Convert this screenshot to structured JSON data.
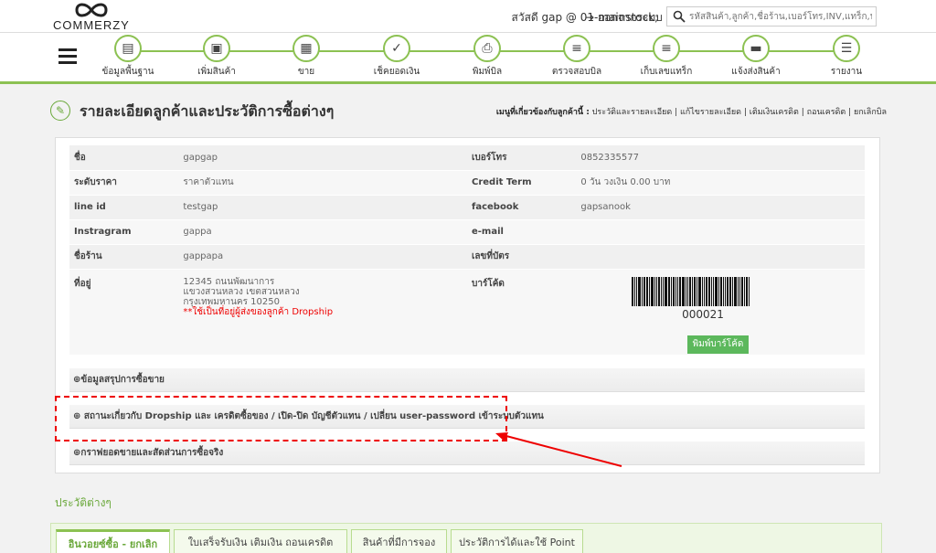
{
  "header": {
    "logo_text": "COMMERZY",
    "greeting_prefix": "สวัสดี",
    "user": "gap @ 01-mainstock,",
    "logout_label": "ออกจากระบบ",
    "search_placeholder": "รหัสสินค้า,ลูกค้า,ชื่อร้าน,เบอร์โทร,INV,แทร็ก,ปลายทาง"
  },
  "nav": {
    "items": [
      {
        "label": "ข้อมูลพื้นฐาน",
        "icon": "database-icon"
      },
      {
        "label": "เพิ่มสินค้า",
        "icon": "box-icon"
      },
      {
        "label": "ขาย",
        "icon": "cash-register-icon"
      },
      {
        "label": "เช็คยอดเงิน",
        "icon": "check-money-icon"
      },
      {
        "label": "พิมพ์บิล",
        "icon": "printer-icon"
      },
      {
        "label": "ตรวจสอบบิล",
        "icon": "barcode-scanner-icon"
      },
      {
        "label": "เก็บเลขแทร็ก",
        "icon": "scanner-icon"
      },
      {
        "label": "แจ้งส่งสินค้า",
        "icon": "truck-icon"
      },
      {
        "label": "รายงาน",
        "icon": "report-icon"
      }
    ]
  },
  "page": {
    "title": "รายละเอียดลูกค้าและประวัติการซื้อต่างๆ",
    "related_menu_label": "เมนูที่เกี่ยวข้องกับลูกค้านี้ :",
    "related_menu_links": "ประวัติและรายละเอียด | แก้ไขรายละเอียด | เติมเงินเครดิต | ถอนเครดิต | ยกเลิกบิล"
  },
  "customer": {
    "name_label": "ชื่อ",
    "name": "gapgap",
    "phone_label": "เบอร์โทร",
    "phone": "0852335577",
    "price_level_label": "ระดับราคา",
    "price_level": "ราคาตัวแทน",
    "credit_term_label": "Credit Term",
    "credit_term": "0 วัน วงเงิน 0.00 บาท",
    "line_label": "line id",
    "line": "testgap",
    "facebook_label": "facebook",
    "facebook": "gapsanook",
    "instagram_label": "Instragram",
    "instagram": "gappa",
    "email_label": "e-mail",
    "email": "",
    "shop_label": "ชื่อร้าน",
    "shop": "gappapa",
    "card_label": "เลขที่บัตร",
    "card": "",
    "address_label": "ที่อยู่",
    "address_line1": "12345 ถนนพัฒนาการ",
    "address_line2": "แขวงสวนหลวง เขตสวนหลวง",
    "address_line3": "กรุงเทพมหานคร 10250",
    "address_note": "**ใช้เป็นที่อยู่ผู้ส่งของลูกค้า Dropship",
    "barcode_label": "บาร์โค้ด",
    "barcode_number": "000021",
    "print_barcode_label": "พิมพ์บาร์โค้ด"
  },
  "sections": {
    "summary": "ข้อมูลสรุปการซื้อขาย",
    "dropship": "สถานะเกี่ยวกับ Dropship และ เครดิตซื้อของ / เปิด-ปิด บัญชีตัวแทน / เปลี่ยน user-password เข้าระบบตัวแทน",
    "graph": "กราฟยอดขายและสัดส่วนการซื้อจริง"
  },
  "history": {
    "title": "ประวัติต่างๆ",
    "tabs": [
      "อินวอยซ์ซื้อ - ยกเลิก",
      "ใบเสร็จรับเงิน เติมเงิน ถอนเครดิต",
      "สินค้าที่มีการจอง",
      "ประวัติการได้และใช้ Point"
    ]
  },
  "colors": {
    "accent": "#8cc152",
    "annotation": "#e00000",
    "button": "#5cb85c"
  }
}
